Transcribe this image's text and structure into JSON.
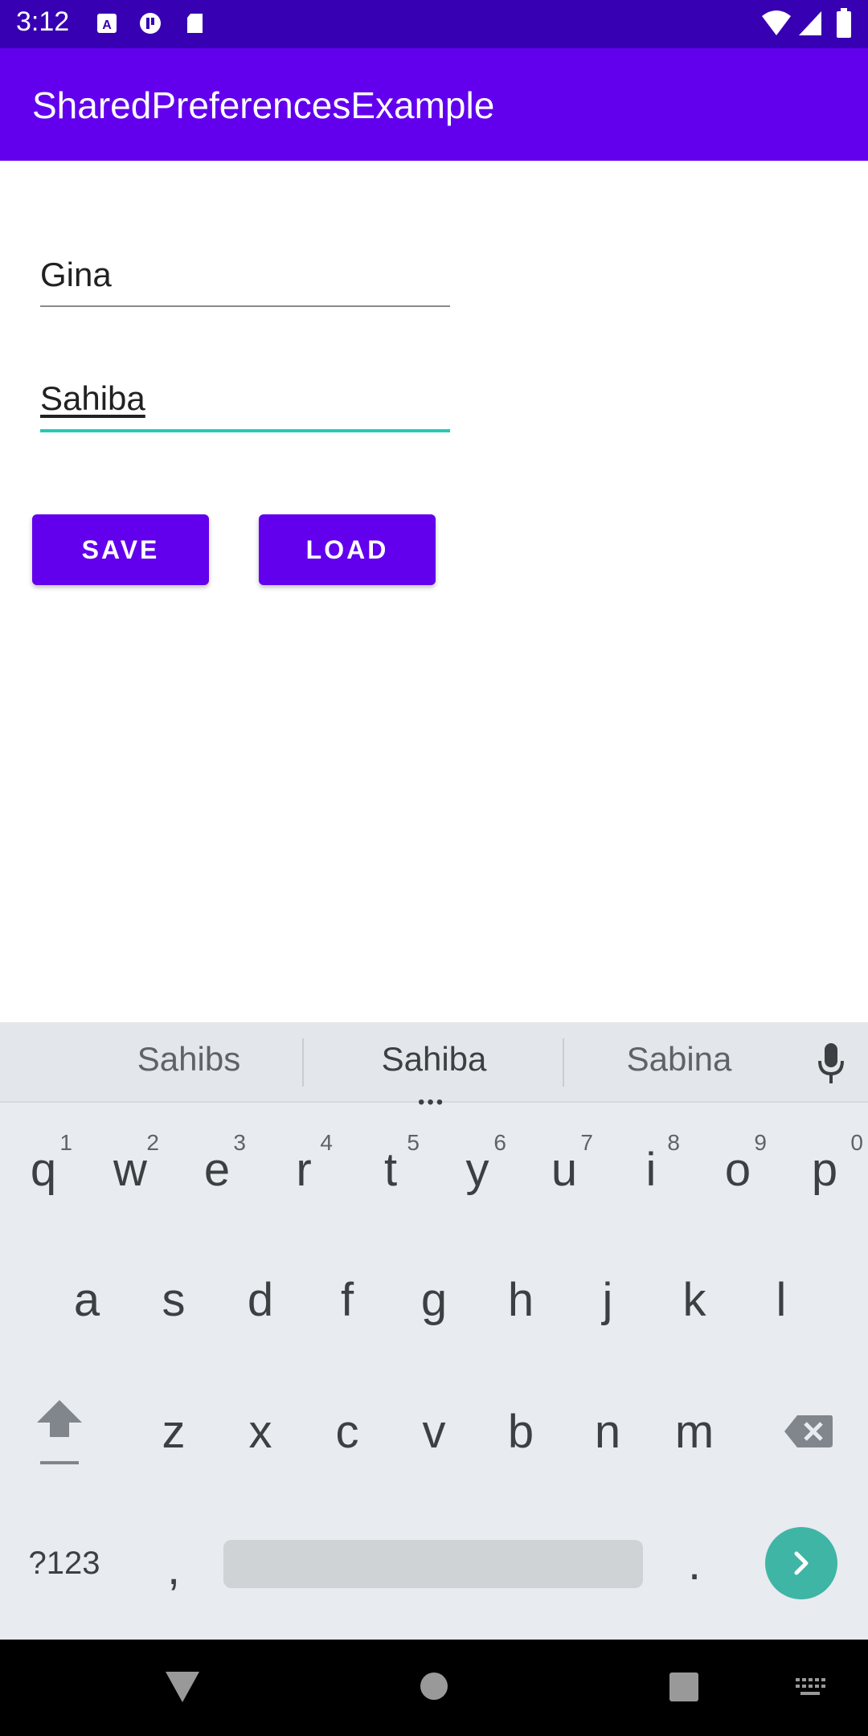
{
  "status_bar": {
    "time": "3:12",
    "icons_left": [
      "a-box-icon",
      "circle-logo-icon",
      "sd-card-icon"
    ],
    "icons_right": [
      "wifi-icon",
      "signal-icon",
      "battery-icon"
    ]
  },
  "app_bar": {
    "title": "SharedPreferencesExample"
  },
  "form": {
    "field1_value": "Gina",
    "field2_value": "Sahiba",
    "save_label": "SAVE",
    "load_label": "LOAD"
  },
  "keyboard": {
    "suggestions": [
      "Sahibs",
      "Sahiba",
      "Sabina"
    ],
    "row1": [
      "q",
      "w",
      "e",
      "r",
      "t",
      "y",
      "u",
      "i",
      "o",
      "p"
    ],
    "row1_hints": [
      "1",
      "2",
      "3",
      "4",
      "5",
      "6",
      "7",
      "8",
      "9",
      "0"
    ],
    "row2": [
      "a",
      "s",
      "d",
      "f",
      "g",
      "h",
      "j",
      "k",
      "l"
    ],
    "row3": [
      "z",
      "x",
      "c",
      "v",
      "b",
      "n",
      "m"
    ],
    "symbols_label": "?123",
    "comma": ",",
    "period": "."
  },
  "colors": {
    "status_bar": "#3700b3",
    "primary": "#6200ee",
    "accent": "#24cbb4",
    "enter_key": "#3fb5a5"
  }
}
